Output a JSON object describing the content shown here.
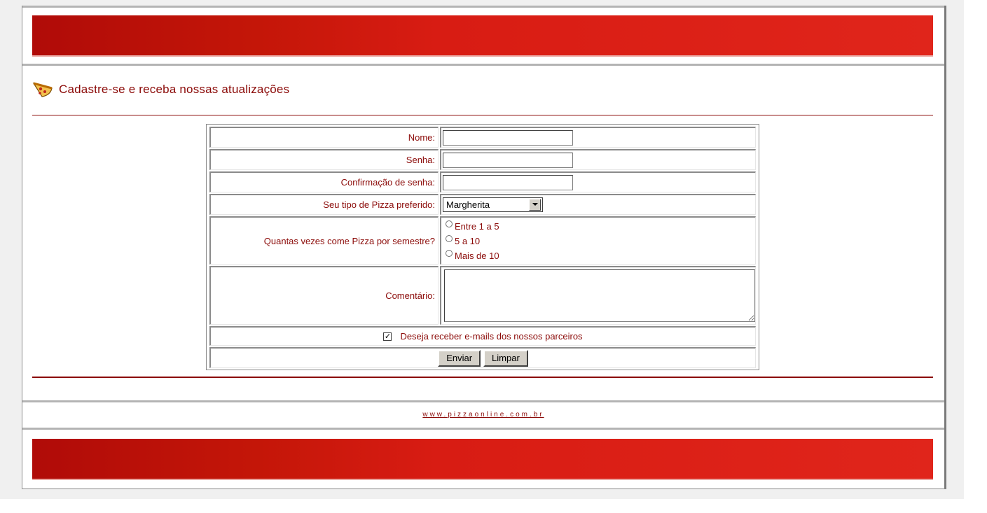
{
  "heading": {
    "title": "Cadastre-se e receba nossas atualizações"
  },
  "form": {
    "nome_label": "Nome:",
    "senha_label": "Senha:",
    "confirm_label": "Confirmação de senha:",
    "pizza_label": "Seu tipo de Pizza preferido:",
    "pizza_selected": "Margherita",
    "frequency_label": "Quantas vezes come Pizza por semestre?",
    "frequency_options": [
      "Entre 1 a 5",
      "5 a 10",
      "Mais de 10"
    ],
    "comment_label": "Comentário:",
    "newsletter_label": "Deseja receber e-mails dos nossos parceiros",
    "newsletter_checked": true,
    "submit_label": "Enviar",
    "reset_label": "Limpar"
  },
  "footer": {
    "link": "www.pizzaonline.com.br"
  },
  "colors": {
    "brand_red": "#d81c13",
    "text_red": "#8b0a08"
  }
}
